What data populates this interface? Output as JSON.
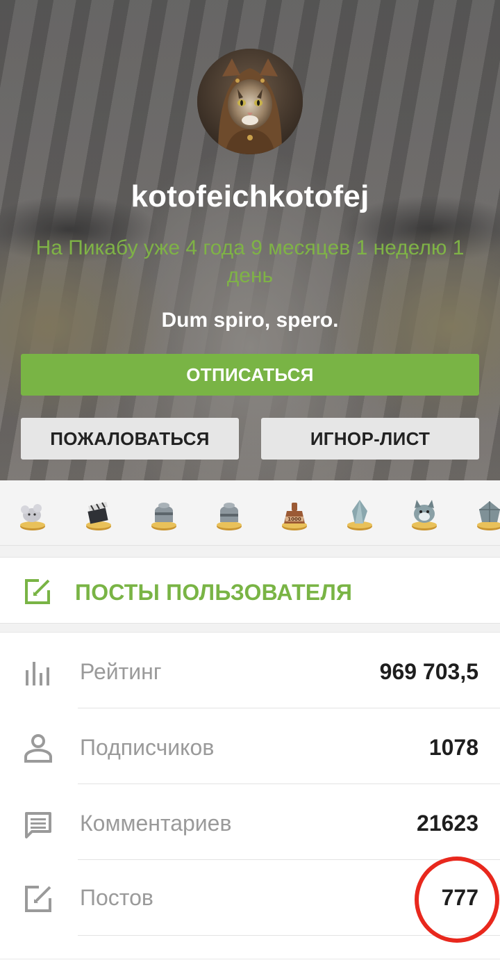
{
  "profile": {
    "username": "kotofeichkotofej",
    "tenure": "На Пикабу уже 4 года 9 месяцев 1 неделю 1 день",
    "motto": "Dum spiro, spero.",
    "avatar_icon": "cat-avatar-icon"
  },
  "actions": {
    "unsubscribe": "ОТПИСАТЬСЯ",
    "report": "ПОЖАЛОВАТЬСЯ",
    "ignore": "ИГНОР-ЛИСТ"
  },
  "awards": [
    {
      "icon": "mouse-award-icon"
    },
    {
      "icon": "clapperboard-award-icon"
    },
    {
      "icon": "helmet-award-icon"
    },
    {
      "icon": "helmet-award-icon"
    },
    {
      "icon": "1000-weight-award-icon"
    },
    {
      "icon": "crystal-award-icon"
    },
    {
      "icon": "animal-award-icon"
    },
    {
      "icon": "gem-award-icon"
    }
  ],
  "posts_link": {
    "label": "ПОСТЫ ПОЛЬЗОВАТЕЛЯ",
    "icon": "edit-icon"
  },
  "stats": [
    {
      "label": "Рейтинг",
      "value": "969 703,5",
      "icon": "chart-icon"
    },
    {
      "label": "Подписчиков",
      "value": "1078",
      "icon": "person-icon"
    },
    {
      "label": "Комментариев",
      "value": "21623",
      "icon": "comment-icon"
    },
    {
      "label": "Постов",
      "value": "777",
      "icon": "edit-icon"
    }
  ],
  "colors": {
    "accent": "#79b445",
    "tenure": "#7fb346",
    "highlight_circle": "#e8281d"
  }
}
